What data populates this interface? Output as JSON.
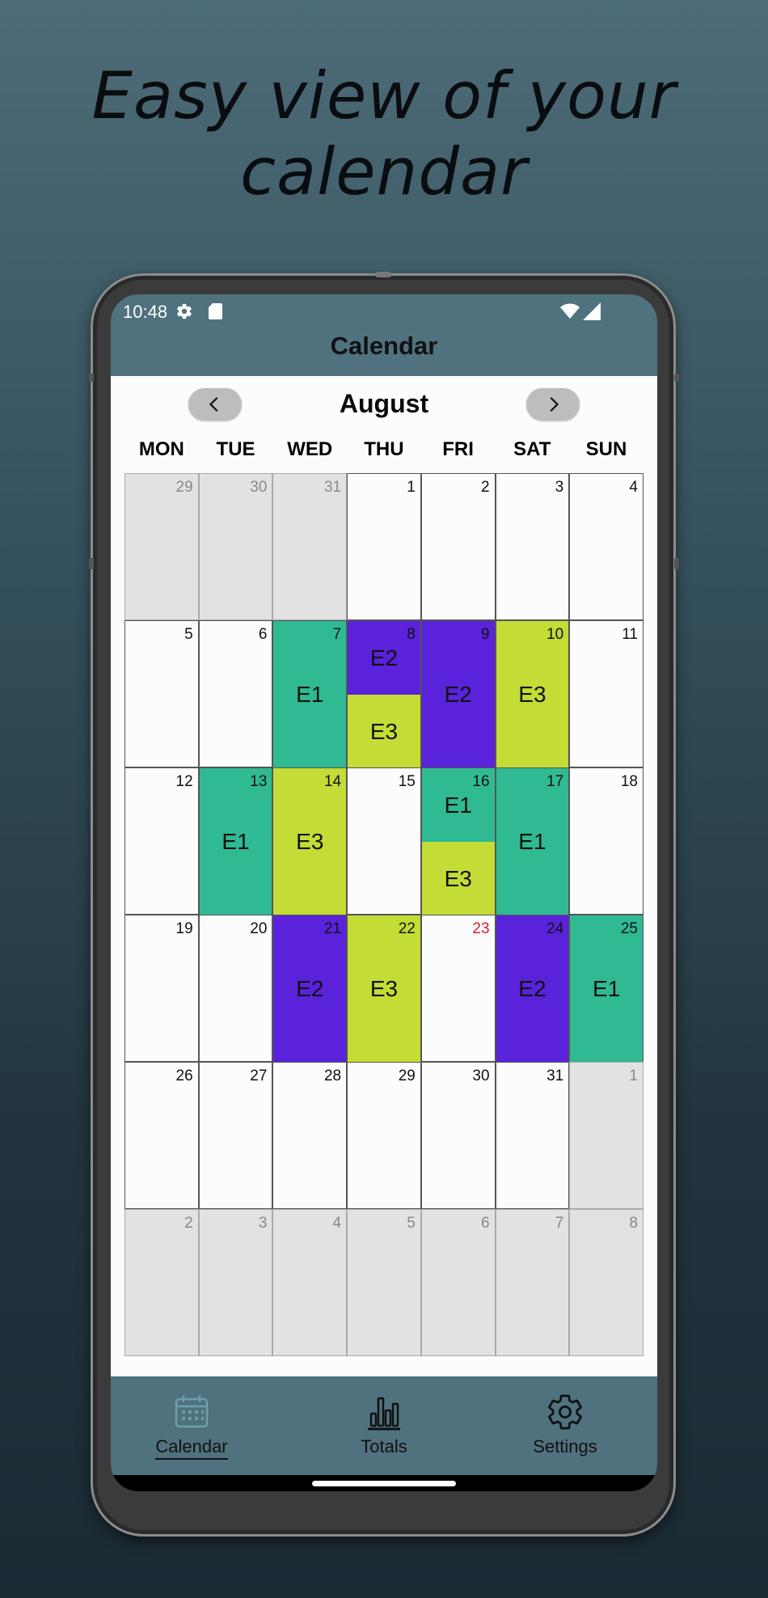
{
  "headline": "Easy view of your calendar",
  "status_bar": {
    "time": "10:48"
  },
  "app_bar": {
    "title": "Calendar"
  },
  "calendar": {
    "month": "August",
    "weekdays": [
      "MON",
      "TUE",
      "WED",
      "THU",
      "FRI",
      "SAT",
      "SUN"
    ],
    "weeks": [
      [
        {
          "day": "29",
          "other": true
        },
        {
          "day": "30",
          "other": true
        },
        {
          "day": "31",
          "other": true
        },
        {
          "day": "1"
        },
        {
          "day": "2"
        },
        {
          "day": "3"
        },
        {
          "day": "4"
        }
      ],
      [
        {
          "day": "5"
        },
        {
          "day": "6"
        },
        {
          "day": "7",
          "events": [
            "E1"
          ]
        },
        {
          "day": "8",
          "events": [
            "E2",
            "E3"
          ]
        },
        {
          "day": "9",
          "events": [
            "E2"
          ]
        },
        {
          "day": "10",
          "events": [
            "E3"
          ]
        },
        {
          "day": "11"
        }
      ],
      [
        {
          "day": "12"
        },
        {
          "day": "13",
          "events": [
            "E1"
          ]
        },
        {
          "day": "14",
          "events": [
            "E3"
          ]
        },
        {
          "day": "15"
        },
        {
          "day": "16",
          "events": [
            "E1",
            "E3"
          ]
        },
        {
          "day": "17",
          "events": [
            "E1"
          ]
        },
        {
          "day": "18"
        }
      ],
      [
        {
          "day": "19"
        },
        {
          "day": "20"
        },
        {
          "day": "21",
          "events": [
            "E2"
          ]
        },
        {
          "day": "22",
          "events": [
            "E3"
          ]
        },
        {
          "day": "23",
          "holiday": true
        },
        {
          "day": "24",
          "events": [
            "E2"
          ]
        },
        {
          "day": "25",
          "events": [
            "E1"
          ]
        }
      ],
      [
        {
          "day": "26"
        },
        {
          "day": "27"
        },
        {
          "day": "28"
        },
        {
          "day": "29"
        },
        {
          "day": "30"
        },
        {
          "day": "31"
        },
        {
          "day": "1",
          "other": true
        }
      ],
      [
        {
          "day": "2",
          "other": true
        },
        {
          "day": "3",
          "other": true
        },
        {
          "day": "4",
          "other": true
        },
        {
          "day": "5",
          "other": true
        },
        {
          "day": "6",
          "other": true
        },
        {
          "day": "7",
          "other": true
        },
        {
          "day": "8",
          "other": true
        }
      ]
    ],
    "event_colors": {
      "E1": "#2fba93",
      "E2": "#5a22da",
      "E3": "#c4dc35"
    }
  },
  "bottom_nav": [
    {
      "label": "Calendar",
      "icon": "calendar-icon",
      "active": true
    },
    {
      "label": "Totals",
      "icon": "bar-chart-icon",
      "active": false
    },
    {
      "label": "Settings",
      "icon": "gear-icon",
      "active": false
    }
  ]
}
